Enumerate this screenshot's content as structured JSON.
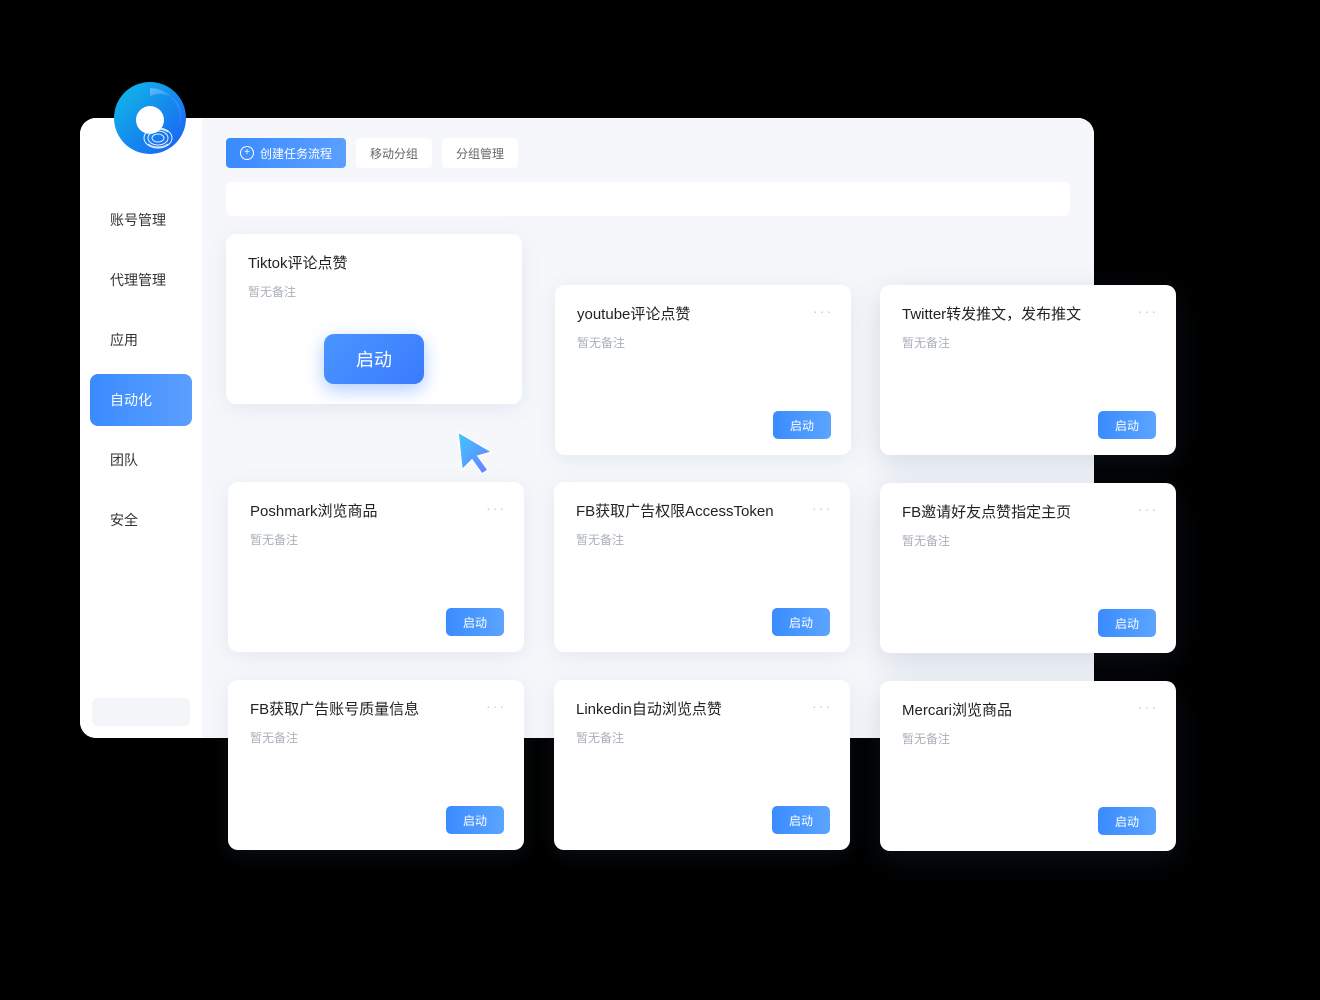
{
  "sidebar": {
    "items": [
      {
        "label": "账号管理"
      },
      {
        "label": "代理管理"
      },
      {
        "label": "应用"
      },
      {
        "label": "自动化"
      },
      {
        "label": "团队"
      },
      {
        "label": "安全"
      }
    ],
    "activeIndex": 3
  },
  "toolbar": {
    "create_task": "创建任务流程",
    "move_group": "移动分组",
    "group_manage": "分组管理"
  },
  "common": {
    "note_placeholder": "暂无备注",
    "start_label": "启动",
    "more_icon": "···"
  },
  "cards": [
    {
      "title": "Tiktok评论点赞",
      "note": "暂无备注",
      "highlight": true
    },
    {
      "title": "youtube评论点赞",
      "note": "暂无备注"
    },
    {
      "title": "Twitter转发推文，发布推文",
      "note": "暂无备注"
    },
    {
      "title": "Poshmark浏览商品",
      "note": "暂无备注"
    },
    {
      "title": "FB获取广告权限AccessToken",
      "note": "暂无备注"
    },
    {
      "title": "FB邀请好友点赞指定主页",
      "note": "暂无备注"
    },
    {
      "title": "FB获取广告账号质量信息",
      "note": "暂无备注"
    },
    {
      "title": "Linkedin自动浏览点赞",
      "note": "暂无备注"
    },
    {
      "title": "Mercari浏览商品",
      "note": "暂无备注"
    }
  ]
}
